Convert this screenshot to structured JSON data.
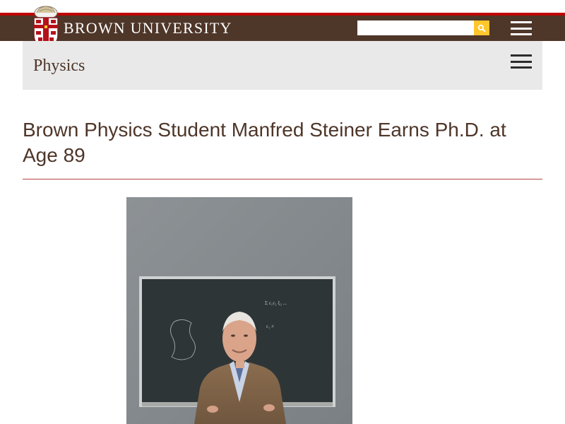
{
  "header": {
    "university_name": "BROWN UNIVERSITY",
    "logo_icon": "brown-shield-logo-icon",
    "search_placeholder": "",
    "search_icon": "search-icon",
    "menu_icon": "hamburger-menu-icon"
  },
  "department": {
    "name": "Physics",
    "menu_icon": "hamburger-menu-icon"
  },
  "article": {
    "title": "Brown Physics Student Manfred Steiner Earns Ph.D. at Age 89",
    "photo_description_icon": "portrait-photo"
  },
  "colors": {
    "brand_brown": "#4e3629",
    "brand_red": "#c00404",
    "search_button": "#ffc72c",
    "department_bar": "#e9e9e9",
    "divider": "#b34343"
  }
}
